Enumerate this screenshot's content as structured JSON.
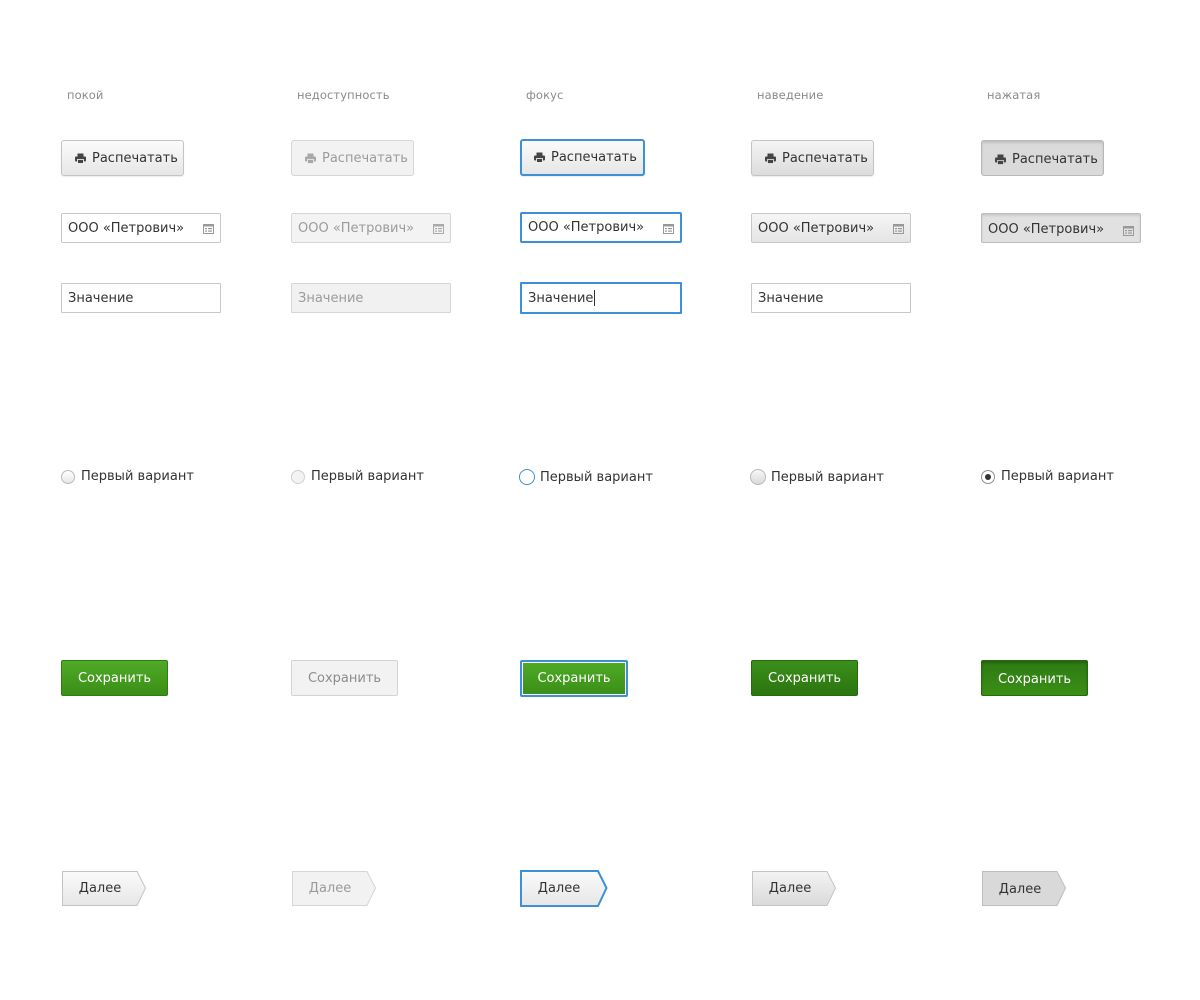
{
  "states": {
    "normal": "покой",
    "disabled": "недоступность",
    "focus": "фокус",
    "hover": "наведение",
    "pressed": "нажатая"
  },
  "controls": {
    "print_label": "Распечатать",
    "select_value": "ООО «Петрович»",
    "input_value": "Значение",
    "radio_label": "Первый вариант",
    "save_label": "Сохранить",
    "next_label": "Далее"
  },
  "icons": {
    "print": "printer-icon",
    "select_trigger": "calendar-list-icon"
  },
  "colors": {
    "focus_outline": "#3d8fd6",
    "primary_green": "#46a020",
    "primary_green_hover": "#327f14",
    "label_gray": "#8a8a8a",
    "disabled_text": "#9b9b9b"
  }
}
